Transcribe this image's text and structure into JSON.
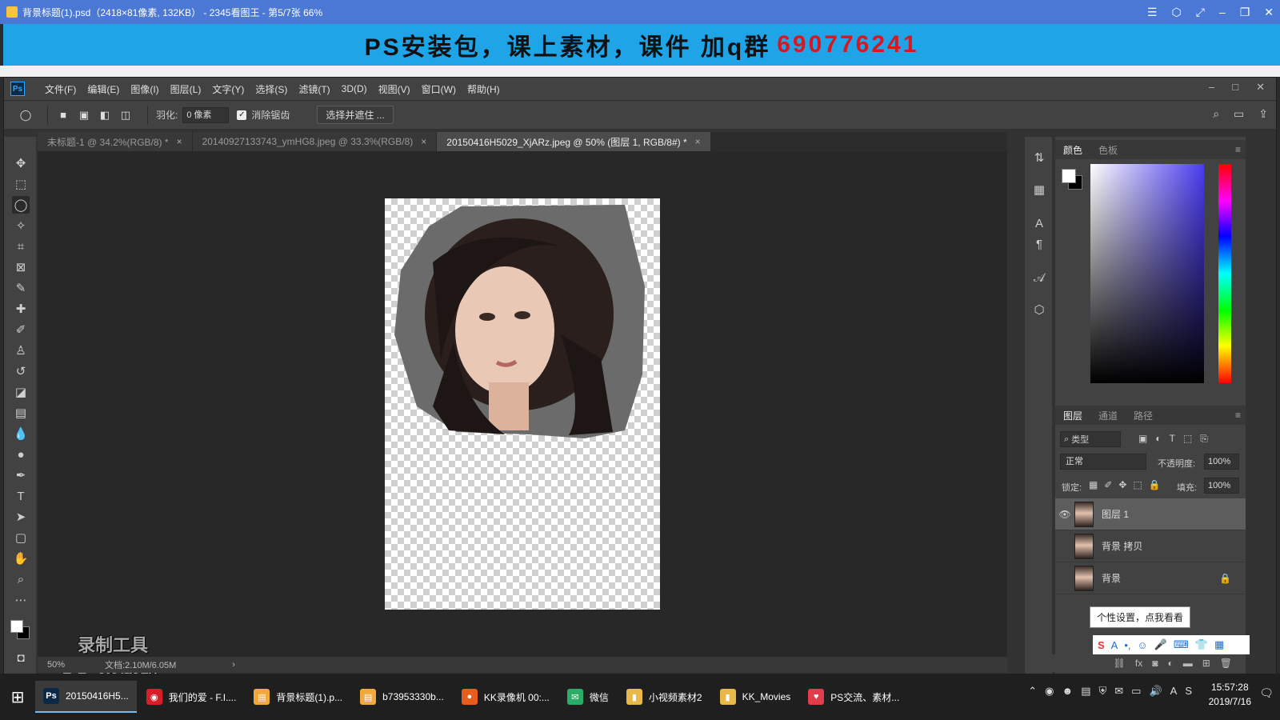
{
  "viewer": {
    "title": "背景标题(1).psd（2418×81像素, 132KB） - 2345看图王 - 第5/7张 66%",
    "controls": [
      "☰",
      "⬡",
      "⤢",
      "–",
      "❐",
      "✕"
    ]
  },
  "banner": {
    "text": "PS安装包，课上素材，课件 加q群",
    "number": "690776241"
  },
  "ps": {
    "logo": "Ps",
    "menu": [
      "文件(F)",
      "编辑(E)",
      "图像(I)",
      "图层(L)",
      "文字(Y)",
      "选择(S)",
      "滤镜(T)",
      "3D(D)",
      "视图(V)",
      "窗口(W)",
      "帮助(H)"
    ],
    "options": {
      "feather_label": "羽化:",
      "feather_value": "0 像素",
      "antialias_label": "消除锯齿",
      "select_mask_button": "选择并遮住 ..."
    },
    "tabs": [
      {
        "label": "未标题-1 @ 34.2%(RGB/8) *"
      },
      {
        "label": "20140927133743_ymHG8.jpeg @ 33.3%(RGB/8)"
      },
      {
        "label": "20150416H5029_XjARz.jpeg @ 50% (图层 1, RGB/8#) *"
      }
    ],
    "watermark": {
      "line1": "录制工具",
      "line2": "KK 录像机"
    },
    "status": {
      "zoom": "50%",
      "doc": "文档:2.10M/6.05M",
      "arrow": "›"
    },
    "color_panel": {
      "tabs": [
        "颜色",
        "色板"
      ]
    },
    "layers_panel": {
      "tabs": [
        "图层",
        "通道",
        "路径"
      ],
      "filter": "类型",
      "blend_mode": "正常",
      "opacity_label": "不透明度:",
      "opacity_value": "100%",
      "lock_label": "锁定:",
      "fill_label": "填充:",
      "fill_value": "100%",
      "layers": [
        {
          "name": "图层 1",
          "selected": true,
          "visible": true
        },
        {
          "name": "背景 拷贝",
          "selected": false,
          "visible": false
        },
        {
          "name": "背景",
          "selected": false,
          "visible": false,
          "locked": true
        }
      ]
    }
  },
  "tooltip": "个性设置，点我看看",
  "taskbar": {
    "items": [
      {
        "label": "20150416H5...",
        "icon": "Ps",
        "color": "#0b2a48",
        "active": true
      },
      {
        "label": "我们的爱 - F.I....",
        "icon": "◉",
        "color": "#d81e28",
        "active": false
      },
      {
        "label": "背景标题(1).p...",
        "icon": "▤",
        "color": "#f2a93b",
        "active": false
      },
      {
        "label": "b73953330b...",
        "icon": "▤",
        "color": "#f2a93b",
        "active": false
      },
      {
        "label": "KK录像机 00:...",
        "icon": "●",
        "color": "#e85d1e",
        "active": false
      },
      {
        "label": "微信",
        "icon": "✉",
        "color": "#2aae67",
        "active": false
      },
      {
        "label": "小视频素材2",
        "icon": "▮",
        "color": "#e8b948",
        "active": false
      },
      {
        "label": "KK_Movies",
        "icon": "▮",
        "color": "#e8b948",
        "active": false
      },
      {
        "label": "PS交流、素材...",
        "icon": "♥",
        "color": "#e23d4a",
        "active": false
      }
    ],
    "time": "15:57:28",
    "date": "2019/7/16"
  }
}
